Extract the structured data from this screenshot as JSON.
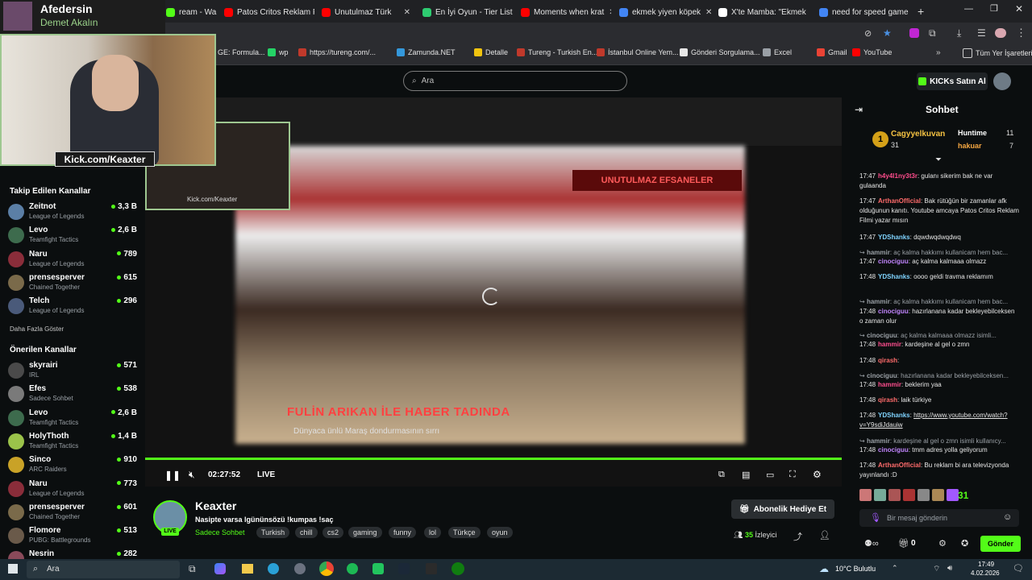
{
  "overlay": {
    "line1": "Afedersin",
    "line2": "Demet Akalın",
    "kick_tag": "Kick.com/Keaxter"
  },
  "tabs": [
    {
      "label": "ream - Wa",
      "color": "#53fc18"
    },
    {
      "label": "Patos Critos Reklam F",
      "color": "#ff0000"
    },
    {
      "label": "Unutulmaz Türk",
      "color": "#ff0000"
    },
    {
      "label": "En İyi Oyun - Tier List",
      "color": "#2ecc71"
    },
    {
      "label": "Moments when krat",
      "color": "#ff0000"
    },
    {
      "label": "ekmek yiyen köpek",
      "color": "#4285f4"
    },
    {
      "label": "X'te Mamba: \"Ekmek",
      "color": "#ffffff"
    },
    {
      "label": "need for speed game",
      "color": "#4285f4"
    }
  ],
  "bookmarks": [
    {
      "label": "GE: Formula...",
      "color": "#9aa0a6"
    },
    {
      "label": "wp",
      "color": "#25d366"
    },
    {
      "label": "https://tureng.com/...",
      "color": "#c0392b"
    },
    {
      "label": "Zamunda.NET",
      "color": "#3498db"
    },
    {
      "label": "Detalle",
      "color": "#f1c40f"
    },
    {
      "label": "Tureng - Turkish En...",
      "color": "#c0392b"
    },
    {
      "label": "İstanbul Online Yem...",
      "color": "#c0392b"
    },
    {
      "label": "Gönderi Sorgulama...",
      "color": "#e6e6e6"
    },
    {
      "label": "Excel",
      "color": "#9aa0a6"
    },
    {
      "label": "Gmail",
      "color": "#ea4335"
    },
    {
      "label": "YouTube",
      "color": "#ff0000"
    }
  ],
  "bookmarks_all": "Tüm Yer İşaretleri",
  "header": {
    "search_placeholder": "Ara",
    "kicks_label": "KICKs Satın Al"
  },
  "sidebar": {
    "followed_title": "Takip Edilen Kanallar",
    "followed": [
      {
        "name": "Zeitnot",
        "game": "League of Legends",
        "viewers": "3,3 B",
        "dot": true,
        "color": "#5b7fa6"
      },
      {
        "name": "Levo",
        "game": "Teamfight Tactics",
        "viewers": "2,6 B",
        "dot": true,
        "color": "#3d6b4d"
      },
      {
        "name": "Naru",
        "game": "League of Legends",
        "viewers": "789",
        "dot": true,
        "color": "#8a2d3a"
      },
      {
        "name": "prensesperver",
        "game": "Chained Together",
        "viewers": "615",
        "dot": true,
        "color": "#7a6a4a"
      },
      {
        "name": "Telch",
        "game": "League of Legends",
        "viewers": "296",
        "dot": true,
        "color": "#4a5a7a"
      }
    ],
    "more_label": "Daha Fazla Göster",
    "recommended_title": "Önerilen Kanallar",
    "recommended": [
      {
        "name": "skyrairi",
        "game": "IRL",
        "viewers": "571",
        "dot": true,
        "color": "#4a4a4a"
      },
      {
        "name": "Efes",
        "game": "Sadece Sohbet",
        "viewers": "538",
        "dot": true,
        "color": "#7a7a7a"
      },
      {
        "name": "Levo",
        "game": "Teamfight Tactics",
        "viewers": "2,6 B",
        "dot": true,
        "color": "#3d6b4d"
      },
      {
        "name": "HolyThoth",
        "game": "Teamfight Tactics",
        "viewers": "1,4 B",
        "dot": true,
        "color": "#9bc34a"
      },
      {
        "name": "Sinco",
        "game": "ARC Raiders",
        "viewers": "910",
        "dot": true,
        "color": "#c9a227"
      },
      {
        "name": "Naru",
        "game": "League of Legends",
        "viewers": "773",
        "dot": true,
        "color": "#8a2d3a"
      },
      {
        "name": "prensesperver",
        "game": "Chained Together",
        "viewers": "601",
        "dot": true,
        "color": "#7a6a4a"
      },
      {
        "name": "Flomore",
        "game": "PUBG: Battlegrounds",
        "viewers": "513",
        "dot": true,
        "color": "#6a5a4a"
      },
      {
        "name": "Nesrin",
        "game": "",
        "viewers": "282",
        "dot": true,
        "color": "#8a4a5a"
      }
    ]
  },
  "video": {
    "banner_top": "UNUTULMAZ EFSANELER",
    "caption_main": "FULİN ARIKAN İLE HABER TADINDA",
    "caption_sub": "Dünyaca ünlü Maraş dondurmasının sırrı",
    "time": "02:27:52",
    "live": "LIVE",
    "progress": 1.0,
    "inner_cam_label": "Kick.com/Keaxter"
  },
  "stream": {
    "name": "Keaxter",
    "title": "Nasipte varsa lgününsözü !kumpas !saç",
    "category": "Sadece Sohbet",
    "live_badge": "LIVE",
    "tags": [
      "Turkish",
      "chill",
      "cs2",
      "gaming",
      "funny",
      "lol",
      "Türkçe",
      "oyun"
    ],
    "sub_button": "Abonelik Hediye Et",
    "viewers": "35",
    "viewers_label": "İzleyici"
  },
  "chat": {
    "title": "Sohbet",
    "top_gifter": {
      "name": "Cagyyelkuvan",
      "count": "31"
    },
    "gifters": [
      {
        "name": "Huntime",
        "count": "11"
      },
      {
        "name": "hakuar",
        "count": "7"
      }
    ],
    "messages": [
      {
        "time": "17:47",
        "user": "h4y4l1ny3t3r",
        "text": "gulanı sikerim bak ne var gulaanda",
        "color": "#ff4d8d",
        "dim": false
      },
      {
        "time": "17:47",
        "user": "ArthanOfficial",
        "text": "Bak rütüğün bir zamanlar afk olduğunun kanıtı. Youtube amcaya Patos Critos Reklam Filmi yazar mısın",
        "color": "#ff6b6b",
        "dim": false
      },
      {
        "time": "17:47",
        "user": "YDShanks",
        "text": "dqwdwqdwqdwq",
        "color": "#7fd3ff",
        "dim": false
      },
      {
        "time": "",
        "user": "hammir",
        "text": "aç kalma hakkımı kullanicam hem bac...",
        "color": "#9aa0a6",
        "dim": true
      },
      {
        "time": "17:47",
        "user": "cinociguu",
        "text": "aç kalma kalmaaa olmazz",
        "color": "#c084fc",
        "dim": false
      },
      {
        "time": "17:48",
        "user": "YDShanks",
        "text": "oooo geldi travma reklamım",
        "color": "#7fd3ff",
        "dim": false
      },
      {
        "time": "",
        "user": "hammir",
        "text": "aç kalma hakkımı kullanicam hem bac...",
        "color": "#9aa0a6",
        "dim": true
      },
      {
        "time": "17:48",
        "user": "cinociguu",
        "text": "hazırlanana kadar bekleyebilceksen o zaman olur",
        "color": "#c084fc",
        "dim": false
      },
      {
        "time": "",
        "user": "cinociguu",
        "text": "aç kalma kalmaaa olmazz isimli...",
        "color": "#9aa0a6",
        "dim": true
      },
      {
        "time": "17:48",
        "user": "hammir",
        "text": "kardeşine al gel o zmn",
        "color": "#ff4d8d",
        "dim": false
      },
      {
        "time": "17:48",
        "user": "qirash",
        "text": "",
        "color": "#ff6b6b",
        "dim": false
      },
      {
        "time": "",
        "user": "cinociguu",
        "text": "hazırlanana kadar bekleyebilceksen...",
        "color": "#9aa0a6",
        "dim": true
      },
      {
        "time": "17:48",
        "user": "hammir",
        "text": "beklerim yaa",
        "color": "#ff4d8d",
        "dim": false
      },
      {
        "time": "17:48",
        "user": "qirash",
        "text": "laik türkiye",
        "color": "#ff6b6b",
        "dim": false
      },
      {
        "time": "17:48",
        "user": "YDShanks",
        "text": "https://www.youtube.com/watch?v=Y9sdiJdauiw",
        "color": "#7fd3ff",
        "dim": false
      },
      {
        "time": "",
        "user": "hammir",
        "text": "kardeşine al gel o zmn isimli kullanıcy...",
        "color": "#9aa0a6",
        "dim": true
      },
      {
        "time": "17:48",
        "user": "cinociguu",
        "text": "tmm adres yolla geliyorum",
        "color": "#c084fc",
        "dim": false
      },
      {
        "time": "17:48",
        "user": "ArthanOfficial",
        "text": "Bu reklam bi ara televizyonda yayınlandı :D",
        "color": "#ff6b6b",
        "dim": false
      }
    ],
    "emote_count": "31",
    "input_placeholder": "Bir mesaj gönderin",
    "points": "0",
    "send_label": "Gönder"
  },
  "taskbar": {
    "search_placeholder": "Ara",
    "weather": "10°C  Bulutlu",
    "time": "17:49",
    "date": "4.02.2026"
  }
}
